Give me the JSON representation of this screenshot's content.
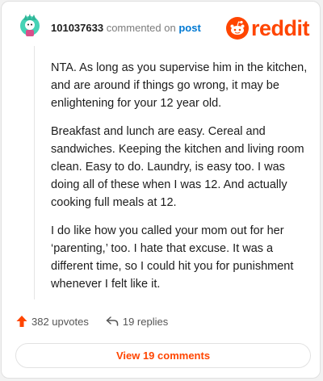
{
  "comment": {
    "username": "101037633",
    "action_text": "commented on",
    "post_link": "post",
    "paragraphs": [
      "NTA. As long as you supervise him in the kitchen, and are around if things go wrong, it may be enlightening for your 12 year old.",
      "Breakfast and lunch are easy. Cereal and sandwiches. Keeping the kitchen and living room clean. Easy to do. Laundry, is easy too. I was doing all of these when I was 12. And actually cooking full meals at 12.",
      "I do like how you called your mom out for her ‘parenting,’ too. I hate that excuse. It was a different time, so I could hit you for punishment whenever I felt like it."
    ]
  },
  "logo": {
    "wordmark": "reddit",
    "color": "#ff4500"
  },
  "stats": {
    "upvotes": "382 upvotes",
    "replies": "19 replies"
  },
  "view_button": {
    "label": "View 19 comments"
  },
  "colors": {
    "accent": "#ff4500",
    "link": "#0079d3",
    "avatar_bg": "#46d3b6"
  },
  "icons": {
    "avatar": "snoo-avatar-icon",
    "logo": "reddit-snoo-icon",
    "upvote": "upvote-arrow-icon",
    "reply": "reply-arrow-icon"
  }
}
